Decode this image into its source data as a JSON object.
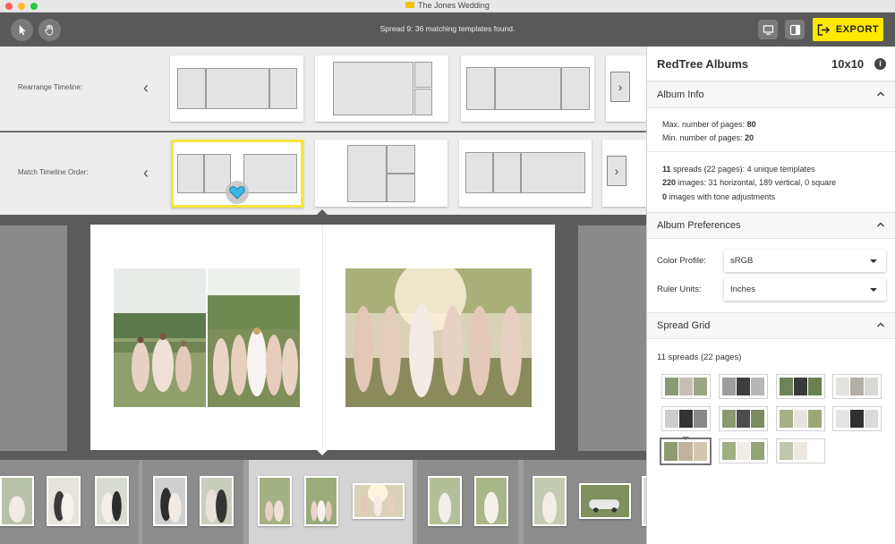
{
  "window": {
    "title": "The Jones Wedding"
  },
  "toolbar": {
    "status": "Spread 9: 36 matching templates found.",
    "export_label": "EXPORT",
    "tools": [
      "arrow-pointer-icon",
      "hand-icon"
    ],
    "view_buttons": [
      "monitor-icon",
      "side-panel-icon"
    ]
  },
  "timeline": {
    "rearrange_label": "Rearrange Timeline:",
    "match_label": "Match Timeline Order:"
  },
  "panel": {
    "brand": "RedTree Albums",
    "size": "10x10",
    "album_info": {
      "title": "Album Info",
      "max_label": "Max. number of pages:",
      "max_value": "80",
      "min_label": "Min. number of pages:",
      "min_value": "20",
      "spreads_count": "11",
      "spreads_text": "spreads (22 pages): 4 unique templates",
      "images_count": "220",
      "images_text": "images: 31 horizontal, 189 vertical, 0 square",
      "tone_count": "0",
      "tone_text": "images with tone adjustments"
    },
    "preferences": {
      "title": "Album Preferences",
      "color_profile_label": "Color Profile:",
      "color_profile_value": "sRGB",
      "ruler_units_label": "Ruler Units:",
      "ruler_units_value": "Inches"
    },
    "spread_grid": {
      "title": "Spread Grid",
      "count_text": "11 spreads (22 pages)"
    }
  },
  "colors": {
    "accent": "#ffe800",
    "selected_border": "#f7e63a",
    "heart": "#3bb7e6"
  }
}
